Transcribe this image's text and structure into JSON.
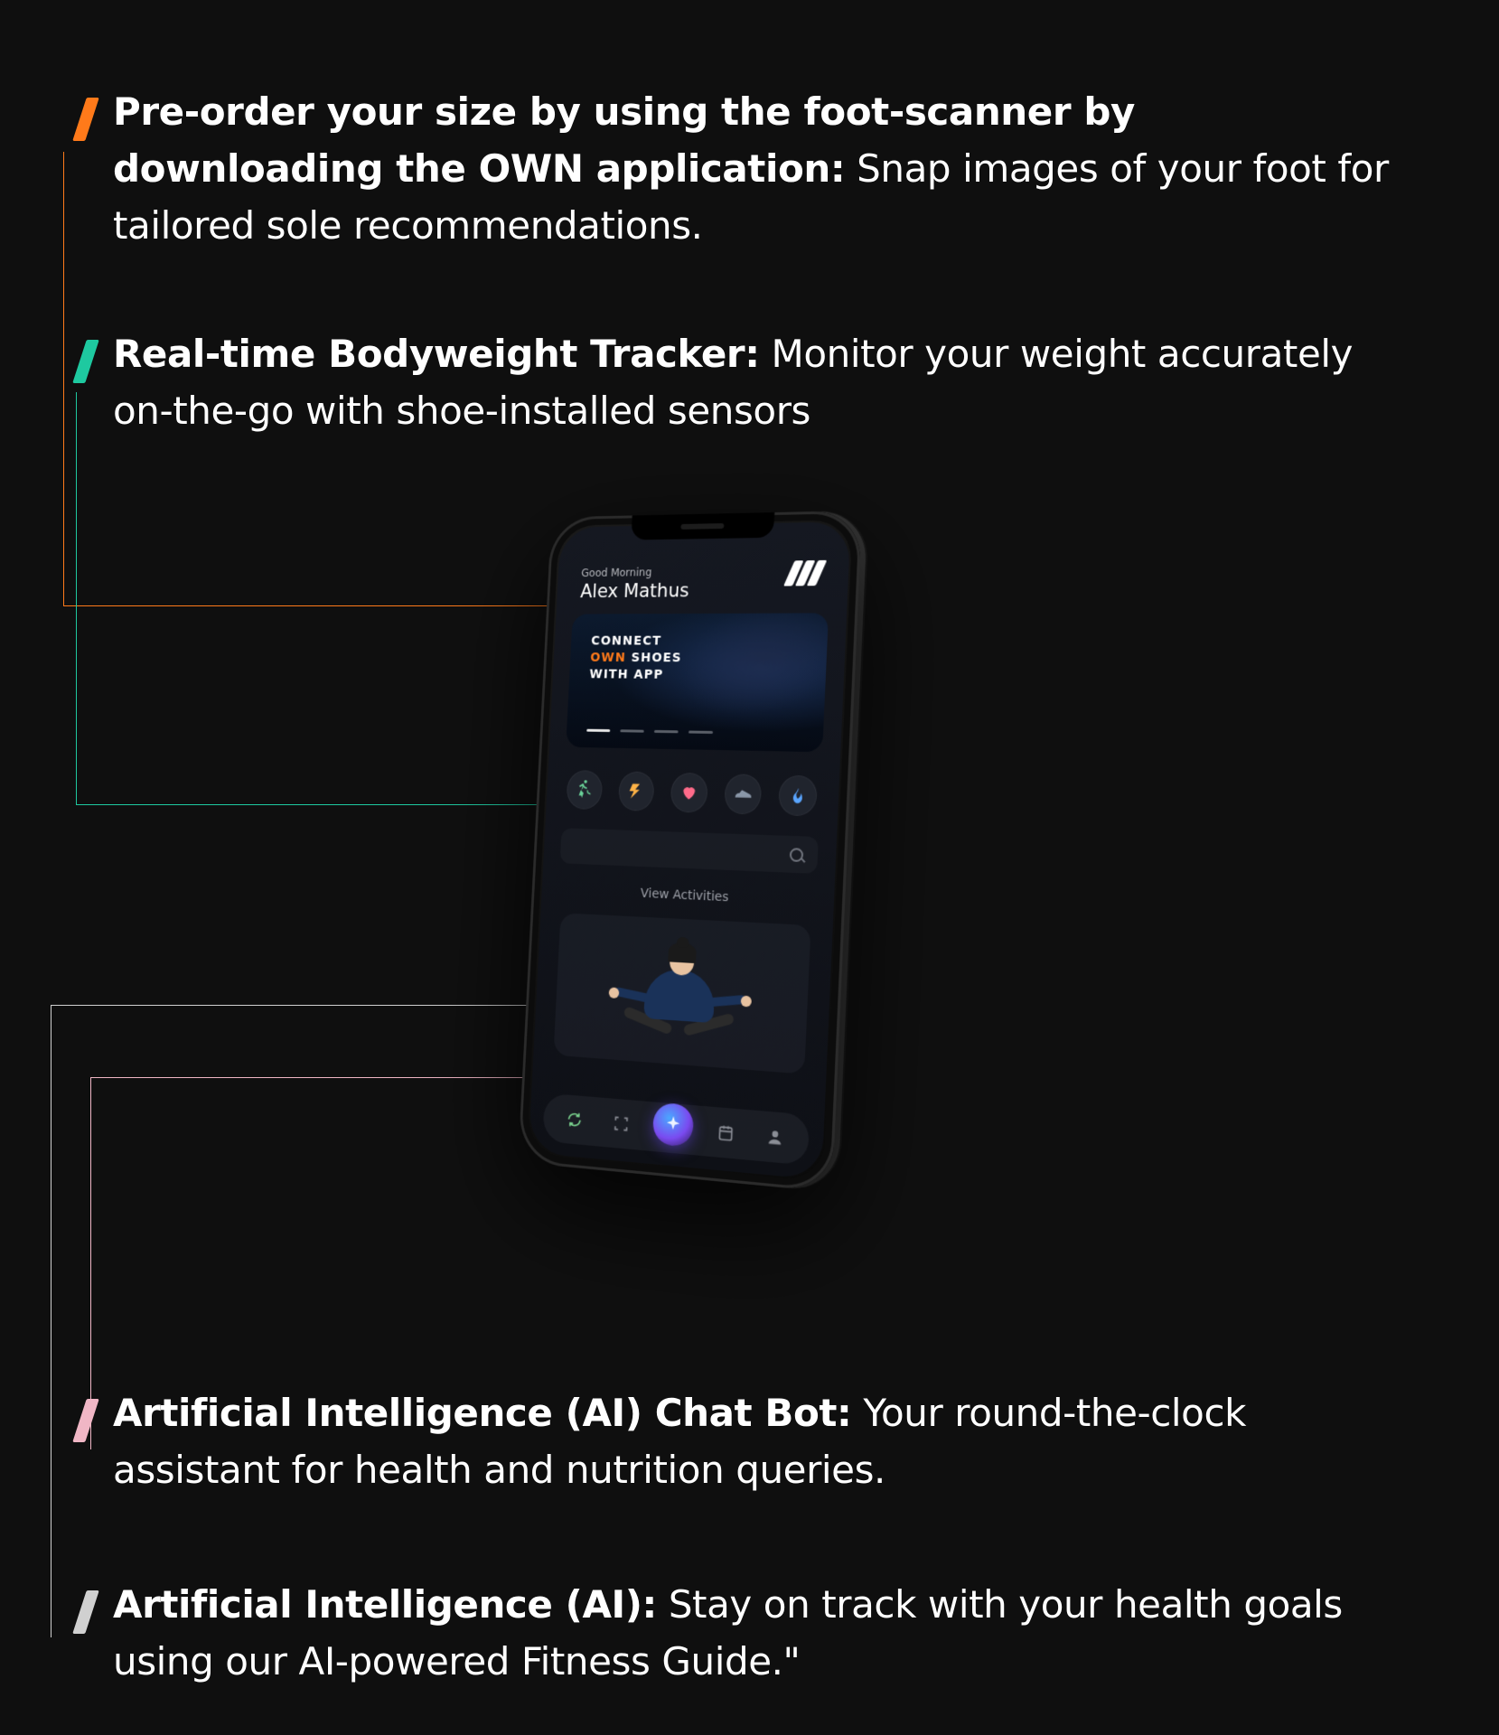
{
  "features": [
    {
      "title": "Pre-order your size by using the foot-scanner by downloading the OWN application:",
      "desc": " Snap images of your foot for tailored sole recommendations.",
      "color": "#ff7a1a"
    },
    {
      "title": "Real-time Bodyweight Tracker:",
      "desc": " Monitor your weight accurately on-the-go with shoe-installed sensors",
      "color": "#1ec9a0"
    },
    {
      "title": "Artificial Intelligence (AI) Chat Bot:",
      "desc": " Your round-the-clock assistant for health and nutrition queries.",
      "color": "#f0b6c5"
    },
    {
      "title": "Artificial Intelligence (AI):",
      "desc": " Stay on track with your health goals using our AI-powered Fitness Guide.\"",
      "color": "#d0d0d0"
    }
  ],
  "phone": {
    "greeting": "Good Morning",
    "username": "Alex Mathus",
    "card_line1": "CONNECT",
    "card_line2_a": "OWN",
    "card_line2_b": " SHOES",
    "card_line3": "WITH APP",
    "view_activities": "View Activities",
    "icons": [
      "run",
      "bolt",
      "heart",
      "shoe",
      "flame"
    ]
  },
  "colors": {
    "orange": "#ff7a1a",
    "teal": "#1ec9a0",
    "pink": "#f0b6c5",
    "grey": "#d0d0d0"
  }
}
